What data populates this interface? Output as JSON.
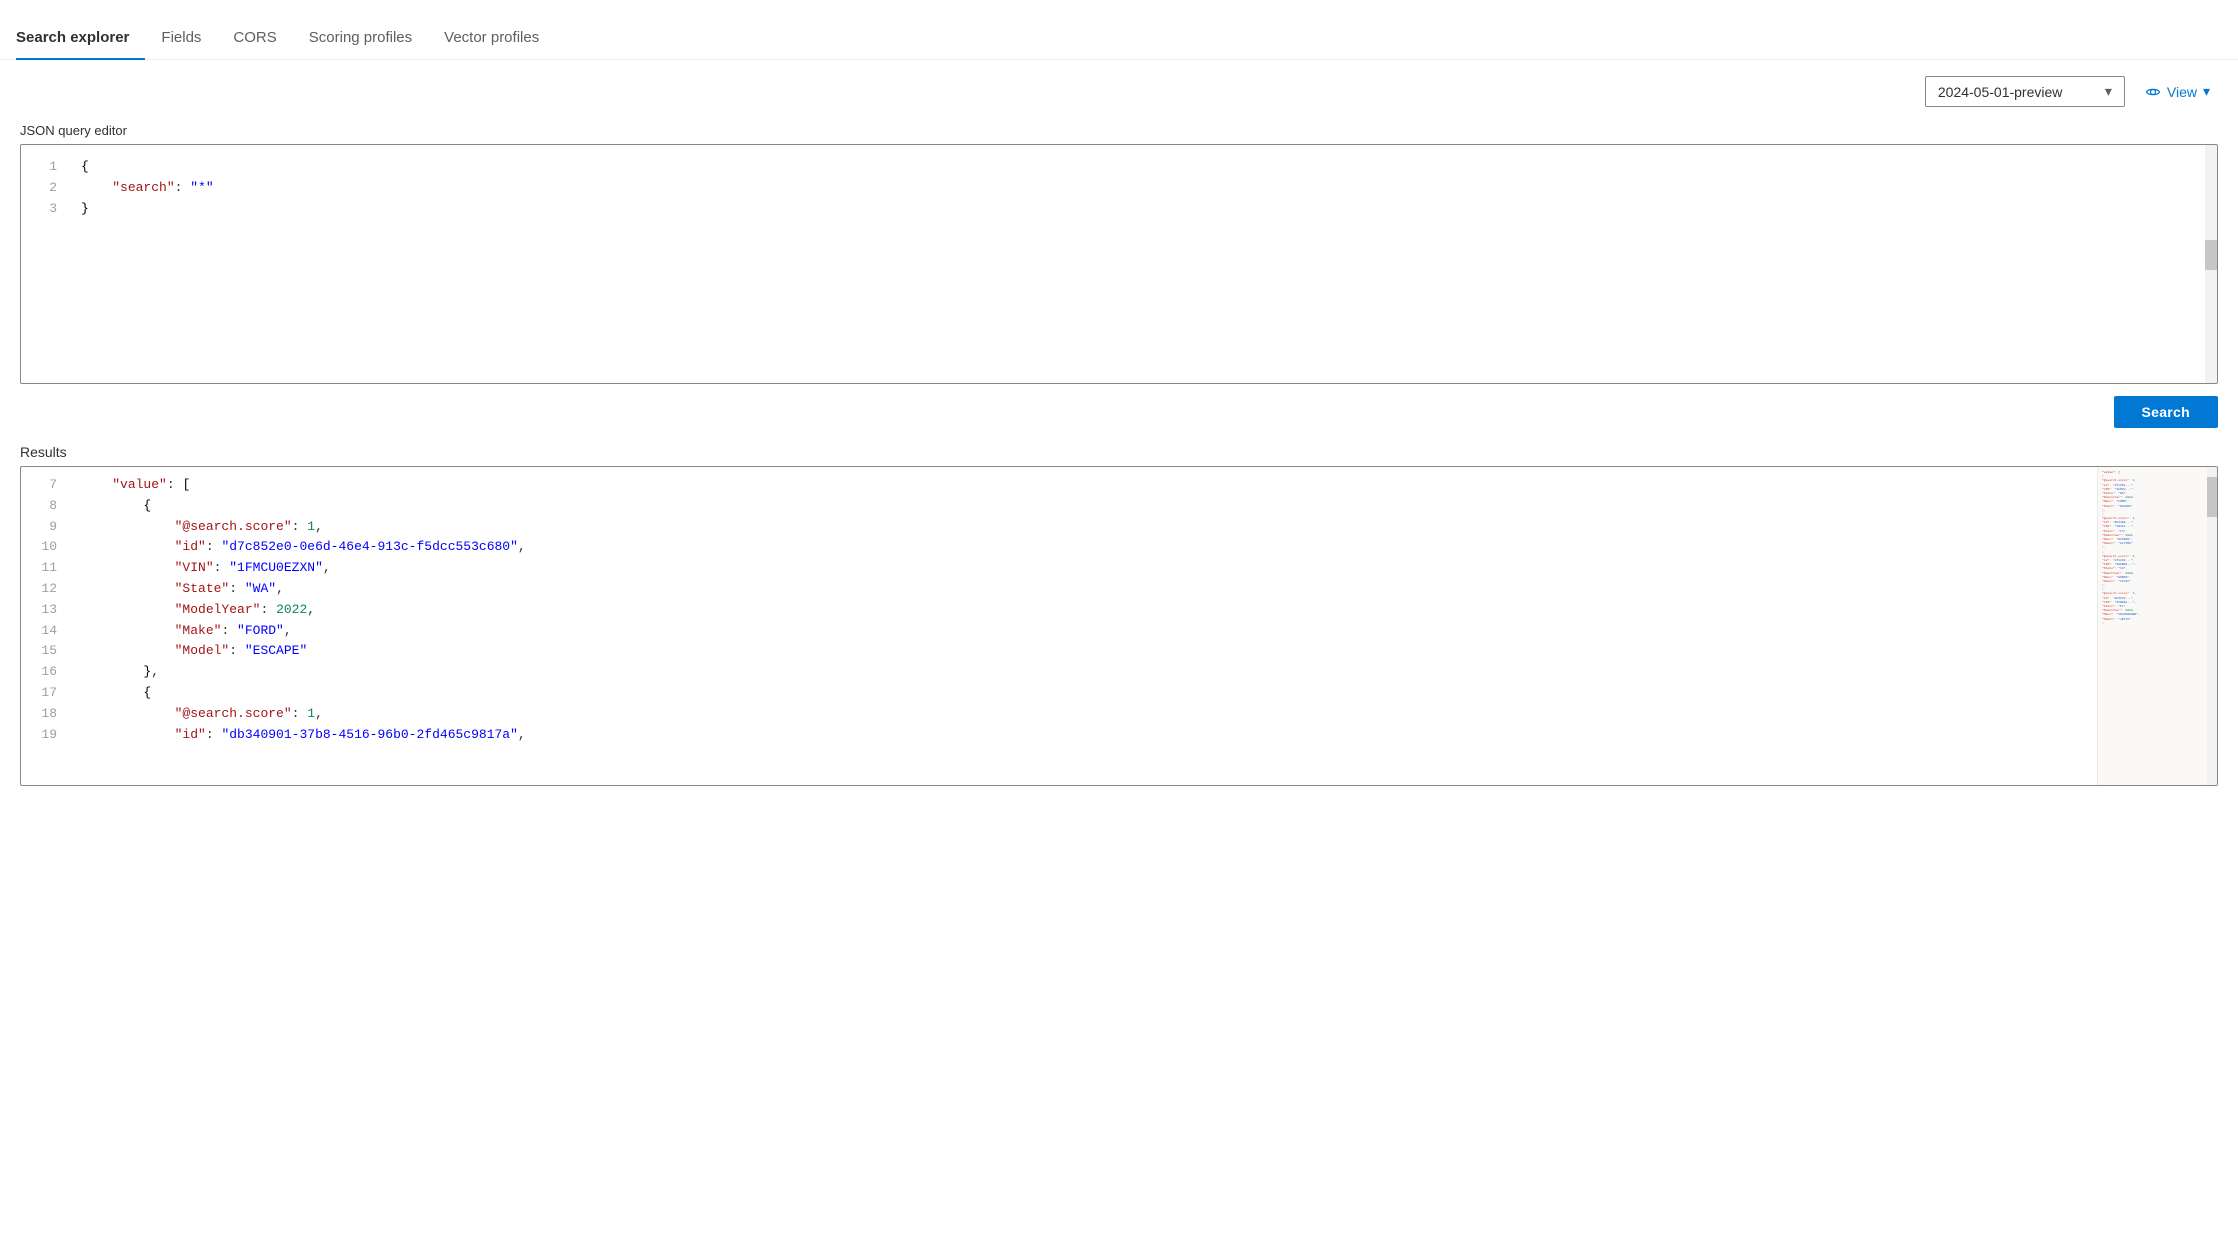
{
  "tabs": [
    {
      "id": "search-explorer",
      "label": "Search explorer",
      "active": true
    },
    {
      "id": "fields",
      "label": "Fields",
      "active": false
    },
    {
      "id": "cors",
      "label": "CORS",
      "active": false
    },
    {
      "id": "scoring-profiles",
      "label": "Scoring profiles",
      "active": false
    },
    {
      "id": "vector-profiles",
      "label": "Vector profiles",
      "active": false
    }
  ],
  "toolbar": {
    "api_version": "2024-05-01-preview",
    "view_label": "View"
  },
  "json_editor": {
    "label": "JSON query editor",
    "lines": [
      {
        "num": 1,
        "content": "{"
      },
      {
        "num": 2,
        "content": "    \"search\": \"*\""
      },
      {
        "num": 3,
        "content": "}"
      }
    ]
  },
  "search_button": {
    "label": "Search"
  },
  "results": {
    "label": "Results",
    "lines": [
      {
        "num": 7,
        "content": "    \"value\": ["
      },
      {
        "num": 8,
        "content": "        {"
      },
      {
        "num": 9,
        "content": "            \"@search.score\": 1,"
      },
      {
        "num": 10,
        "content": "            \"id\": \"d7c852e0-0e6d-46e4-913c-f5dcc553c680\","
      },
      {
        "num": 11,
        "content": "            \"VIN\": \"1FMCU0EZXN\","
      },
      {
        "num": 12,
        "content": "            \"State\": \"WA\","
      },
      {
        "num": 13,
        "content": "            \"ModelYear\": 2022,"
      },
      {
        "num": 14,
        "content": "            \"Make\": \"FORD\","
      },
      {
        "num": 15,
        "content": "            \"Model\": \"ESCAPE\""
      },
      {
        "num": 16,
        "content": "        },"
      },
      {
        "num": 17,
        "content": "        {"
      },
      {
        "num": 18,
        "content": "            \"@search.score\": 1,"
      },
      {
        "num": 19,
        "content": "            \"id\": \"db340901-37b8-4516-96b0-2fd465c9817a\","
      }
    ]
  }
}
